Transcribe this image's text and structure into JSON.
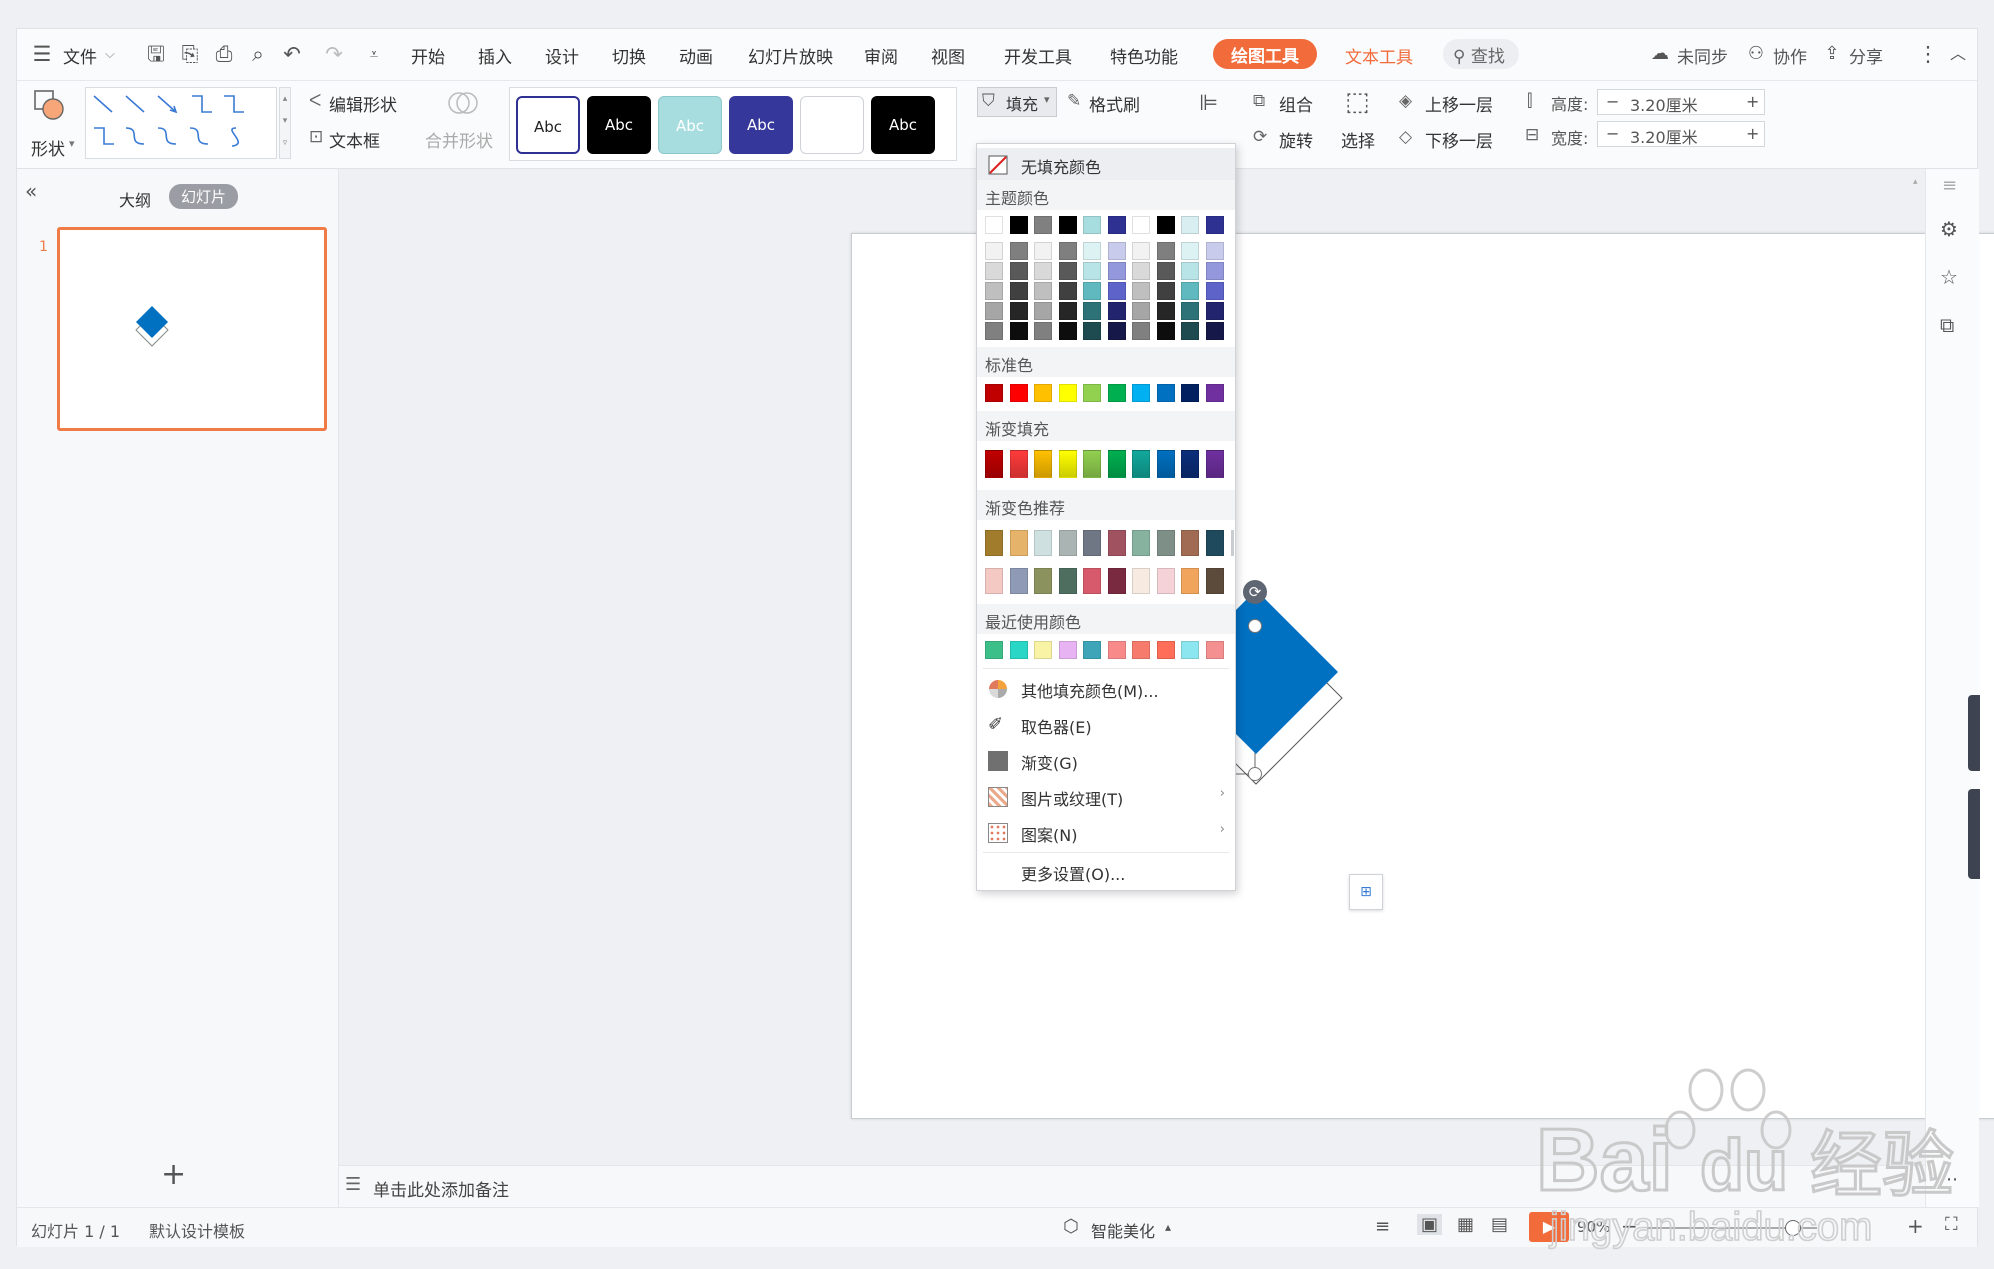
{
  "menubar": {
    "file": "文件",
    "tabs": [
      "开始",
      "插入",
      "设计",
      "切换",
      "动画",
      "幻灯片放映",
      "审阅",
      "视图",
      "开发工具",
      "特色功能"
    ],
    "drawing_tools": "绘图工具",
    "text_tools": "文本工具",
    "search": "查找",
    "unsynced": "未同步",
    "collab": "协作",
    "share": "分享"
  },
  "ribbon": {
    "shape": "形状",
    "edit_shape": "编辑形状",
    "text_box": "文本框",
    "merge_shape": "合并形状",
    "style_label": "Abc",
    "styles": [
      {
        "bg": "#ffffff",
        "fg": "#222222",
        "border": "#2e3192"
      },
      {
        "bg": "#000000",
        "fg": "#ffffff",
        "border": "#000000"
      },
      {
        "bg": "#a8dde0",
        "fg": "#ffffff",
        "border": "#8cc8cc"
      },
      {
        "bg": "#35389a",
        "fg": "#ffffff",
        "border": "#35389a"
      },
      {
        "bg": "#ffffff",
        "fg": "#ffffff",
        "border": "#cfd2d7"
      },
      {
        "bg": "#000000",
        "fg": "#ffffff",
        "border": "#000000"
      }
    ],
    "fill": "填充",
    "format_painter": "格式刷",
    "group": "组合",
    "rotate": "旋转",
    "select": "选择",
    "bring_forward": "上移一层",
    "send_backward": "下移一层",
    "height_label": "高度:",
    "width_label": "宽度:",
    "height_value": "3.20厘米",
    "width_value": "3.20厘米",
    "minus": "−",
    "plus": "+"
  },
  "leftpanel": {
    "outline": "大纲",
    "slides": "幻灯片",
    "slide_number": "1",
    "add": "+"
  },
  "notes": {
    "placeholder": "单击此处添加备注"
  },
  "status": {
    "slide_info": "幻灯片 1 / 1",
    "template": "默认设计模板",
    "beautify": "智能美化",
    "zoom": "90%"
  },
  "dropdown": {
    "no_fill": "无填充颜色",
    "theme_colors": "主题颜色",
    "standard_colors": "标准色",
    "gradient_fill": "渐变填充",
    "gradient_recommend": "渐变色推荐",
    "recent_colors": "最近使用颜色",
    "more_fill_colors": "其他填充颜色(M)...",
    "eyedropper": "取色器(E)",
    "gradient": "渐变(G)",
    "picture_texture": "图片或纹理(T)",
    "pattern": "图案(N)",
    "more_settings": "更多设置(O)...",
    "theme_top": [
      "#ffffff",
      "#000000",
      "#808080",
      "#000000",
      "#a8dde0",
      "#2e3192",
      "#ffffff",
      "#000000",
      "#d9eef0",
      "#2e3192"
    ],
    "theme_grid": [
      [
        "#f2f2f2",
        "#7f7f7f",
        "#f2f2f2",
        "#7f7f7f",
        "#dcf2f3",
        "#c9cbed",
        "#f2f2f2",
        "#7f7f7f",
        "#dcf2f3",
        "#c9cbed"
      ],
      [
        "#d9d9d9",
        "#595959",
        "#d9d9d9",
        "#595959",
        "#b9e4e7",
        "#9397db",
        "#d9d9d9",
        "#595959",
        "#b9e4e7",
        "#9397db"
      ],
      [
        "#bfbfbf",
        "#404040",
        "#bfbfbf",
        "#404040",
        "#5fb9bf",
        "#5d63c9",
        "#bfbfbf",
        "#404040",
        "#5fb9bf",
        "#5d63c9"
      ],
      [
        "#a6a6a6",
        "#262626",
        "#a6a6a6",
        "#262626",
        "#2c7277",
        "#22256e",
        "#a6a6a6",
        "#262626",
        "#2c7277",
        "#22256e"
      ],
      [
        "#808080",
        "#0d0d0d",
        "#808080",
        "#0d0d0d",
        "#1d4b4f",
        "#161849",
        "#808080",
        "#0d0d0d",
        "#1d4b4f",
        "#161849"
      ]
    ],
    "standard": [
      "#c00000",
      "#ff0000",
      "#ffc000",
      "#ffff00",
      "#92d050",
      "#00b050",
      "#00b0f0",
      "#0070c0",
      "#002060",
      "#7030a0"
    ],
    "gradients": [
      "#c00000",
      "#ff3b3b",
      "#ffc000",
      "#ffff00",
      "#92d050",
      "#00b050",
      "#12a89c",
      "#0070c0",
      "#0b2e7a",
      "#7030a0"
    ],
    "recommend_row1": [
      "#a07c2c",
      "#e6b36a",
      "#cfe0e0",
      "#aab5b3",
      "#6f7785",
      "#a05260",
      "#86b29f",
      "#7e8f88",
      "#a06b52",
      "#1f4a5e"
    ],
    "recommend_row2": [
      "#f4c9c4",
      "#8e9ab6",
      "#8c925e",
      "#4e6e60",
      "#d65a6c",
      "#7a2a40",
      "#f7ebe1",
      "#f4d2d7",
      "#f0a45c",
      "#5c4a3a"
    ],
    "recent": [
      "#3dbf8a",
      "#2ad6c6",
      "#f9f3a6",
      "#e7b3f2",
      "#3ea5b8",
      "#f88a8a",
      "#f77b6d",
      "#ff6e58",
      "#8ce6ef",
      "#f49090"
    ]
  },
  "watermark": {
    "brand": "Bai",
    "brand2": "du",
    "cn": "经验",
    "url": "jingyan.baidu.com"
  }
}
